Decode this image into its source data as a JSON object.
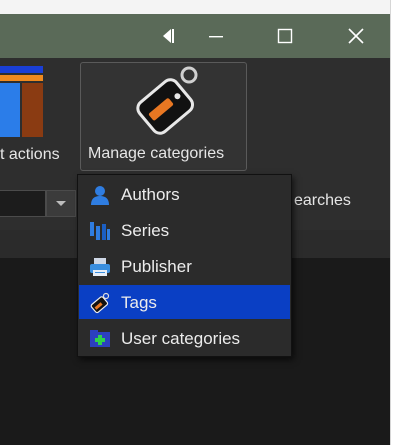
{
  "window": {
    "controls": {
      "back": "back-arrow-icon",
      "minimize": "minimize-icon",
      "maximize": "maximize-icon",
      "close": "close-icon"
    }
  },
  "toolbar": {
    "partial_label": "t actions",
    "manage_categories_label": "Manage categories",
    "saved_searches_partial": "earches"
  },
  "menu": {
    "items": [
      {
        "label": "Authors",
        "icon": "person-icon",
        "selected": false
      },
      {
        "label": "Series",
        "icon": "series-bars-icon",
        "selected": false
      },
      {
        "label": "Publisher",
        "icon": "printer-icon",
        "selected": false
      },
      {
        "label": "Tags",
        "icon": "tag-icon",
        "selected": true
      },
      {
        "label": "User categories",
        "icon": "user-category-icon",
        "selected": false
      }
    ]
  },
  "colors": {
    "titlebar": "#5a6a58",
    "selection": "#0a3fc4",
    "tag_orange": "#e87722"
  }
}
